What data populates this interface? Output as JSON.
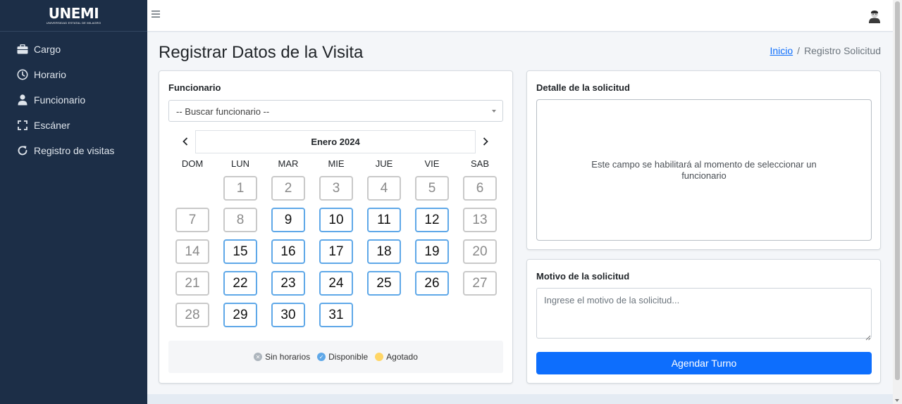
{
  "brand": {
    "name": "UNEMI",
    "subtitle": "UNIVERSIDAD ESTATAL DE MILAGRO"
  },
  "sidebar": {
    "items": [
      {
        "label": "Cargo",
        "icon": "briefcase-icon"
      },
      {
        "label": "Horario",
        "icon": "clock-icon"
      },
      {
        "label": "Funcionario",
        "icon": "user-icon"
      },
      {
        "label": "Escáner",
        "icon": "scan-icon"
      },
      {
        "label": "Registro de visitas",
        "icon": "refresh-icon"
      }
    ]
  },
  "header": {
    "menu_icon": "hamburger-icon",
    "avatar_icon": "user-avatar-icon"
  },
  "page": {
    "title": "Registrar Datos de la Visita",
    "breadcrumb": {
      "home": "Inicio",
      "separator": "/",
      "current": "Registro Solicitud"
    }
  },
  "funcionario": {
    "label": "Funcionario",
    "select_value": "-- Buscar funcionario --"
  },
  "calendar": {
    "month_label": "Enero 2024",
    "weekdays": [
      "DOM",
      "LUN",
      "MAR",
      "MIE",
      "JUE",
      "VIE",
      "SAB"
    ],
    "first_weekday_index": 1,
    "days": [
      {
        "day": "1",
        "status": "sin-horarios"
      },
      {
        "day": "2",
        "status": "sin-horarios"
      },
      {
        "day": "3",
        "status": "sin-horarios"
      },
      {
        "day": "4",
        "status": "sin-horarios"
      },
      {
        "day": "5",
        "status": "sin-horarios"
      },
      {
        "day": "6",
        "status": "sin-horarios"
      },
      {
        "day": "7",
        "status": "sin-horarios"
      },
      {
        "day": "8",
        "status": "sin-horarios"
      },
      {
        "day": "9",
        "status": "disponible"
      },
      {
        "day": "10",
        "status": "disponible"
      },
      {
        "day": "11",
        "status": "disponible"
      },
      {
        "day": "12",
        "status": "disponible"
      },
      {
        "day": "13",
        "status": "sin-horarios"
      },
      {
        "day": "14",
        "status": "sin-horarios"
      },
      {
        "day": "15",
        "status": "disponible"
      },
      {
        "day": "16",
        "status": "disponible"
      },
      {
        "day": "17",
        "status": "disponible"
      },
      {
        "day": "18",
        "status": "disponible"
      },
      {
        "day": "19",
        "status": "disponible"
      },
      {
        "day": "20",
        "status": "sin-horarios"
      },
      {
        "day": "21",
        "status": "sin-horarios"
      },
      {
        "day": "22",
        "status": "disponible"
      },
      {
        "day": "23",
        "status": "disponible"
      },
      {
        "day": "24",
        "status": "disponible"
      },
      {
        "day": "25",
        "status": "disponible"
      },
      {
        "day": "26",
        "status": "disponible"
      },
      {
        "day": "27",
        "status": "sin-horarios"
      },
      {
        "day": "28",
        "status": "sin-horarios"
      },
      {
        "day": "29",
        "status": "disponible"
      },
      {
        "day": "30",
        "status": "disponible"
      },
      {
        "day": "31",
        "status": "disponible"
      }
    ],
    "legend": [
      {
        "label": "Sin horarios",
        "color": "#adb5bd",
        "icon": "x-circle-icon"
      },
      {
        "label": "Disponible",
        "color": "#5fa8e8",
        "icon": "check-circle-icon"
      },
      {
        "label": "Agotado",
        "color": "#ffd666",
        "icon": "dot-circle-icon"
      }
    ]
  },
  "detalle": {
    "label": "Detalle de la solicitud",
    "placeholder_text": "Este campo se habilitará al momento de seleccionar un funcionario"
  },
  "motivo": {
    "label": "Motivo de la solicitud",
    "placeholder": "Ingrese el motivo de la solicitud...",
    "value": ""
  },
  "actions": {
    "submit_label": "Agendar Turno"
  },
  "colors": {
    "sidebar_bg": "#1c2e47",
    "primary": "#0d6efd",
    "available_border": "#5fa8e8",
    "unavailable_border": "#c9c9c9"
  }
}
